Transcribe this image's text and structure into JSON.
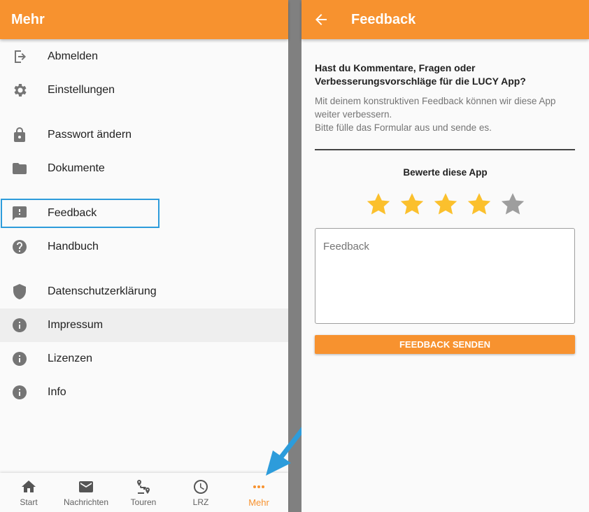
{
  "left": {
    "title": "Mehr",
    "menu": [
      {
        "label": "Abmelden",
        "icon": "logout-icon"
      },
      {
        "label": "Einstellungen",
        "icon": "gear-icon"
      },
      {
        "label": "Passwort ändern",
        "icon": "lock-icon"
      },
      {
        "label": "Dokumente",
        "icon": "folder-icon"
      },
      {
        "label": "Feedback",
        "icon": "feedback-icon"
      },
      {
        "label": "Handbuch",
        "icon": "help-icon"
      },
      {
        "label": "Datenschutzerklärung",
        "icon": "shield-icon"
      },
      {
        "label": "Impressum",
        "icon": "info-icon"
      },
      {
        "label": "Lizenzen",
        "icon": "info-icon"
      },
      {
        "label": "Info",
        "icon": "info-icon"
      }
    ],
    "nav": [
      {
        "label": "Start",
        "icon": "home-icon"
      },
      {
        "label": "Nachrichten",
        "icon": "mail-icon"
      },
      {
        "label": "Touren",
        "icon": "route-icon"
      },
      {
        "label": "LRZ",
        "icon": "clock-icon"
      },
      {
        "label": "Mehr",
        "icon": "more-icon"
      }
    ]
  },
  "right": {
    "title": "Feedback",
    "question": "Hast du Kommentare, Fragen oder Verbesserungsvorschläge für die LUCY App?",
    "desc_line1": "Mit deinem konstruktiven Feedback können wir diese App weiter verbessern.",
    "desc_line2": "Bitte fülle das Formular aus und sende es.",
    "rate_label": "Bewerte diese App",
    "rating": 4,
    "rating_max": 5,
    "feedback_placeholder": "Feedback",
    "feedback_value": "",
    "send_label": "FEEDBACK SENDEN"
  },
  "colors": {
    "accent": "#f7922f",
    "star_on": "#fbc02d",
    "star_off": "#9e9e9e",
    "highlight": "#2d9cdb"
  }
}
